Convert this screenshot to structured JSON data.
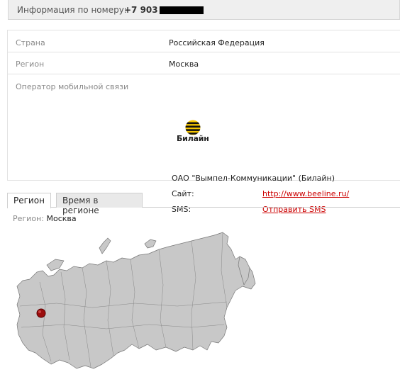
{
  "header": {
    "label": "Информация по номеру:",
    "number": "+7 903"
  },
  "info": {
    "rows": [
      {
        "key": "Страна",
        "value": "Российская Федерация"
      },
      {
        "key": "Регион",
        "value": "Москва"
      }
    ],
    "operator": {
      "key": "Оператор мобильной связи",
      "logo_text": "Билайн",
      "name": "ОАО \"Вымпел-Коммуникации\" (Билайн)",
      "site_label": "Сайт:",
      "site_link": "http://www.beeline.ru/",
      "sms_label": "SMS:",
      "sms_link": "Отправить SMS"
    }
  },
  "tabs": [
    {
      "label": "Регион",
      "active": true
    },
    {
      "label": "Время в регионе",
      "active": false
    }
  ],
  "region_panel": {
    "key": "Регион:",
    "value": "Москва"
  },
  "colors": {
    "link": "#cc0000",
    "map_fill": "#c8c8c8",
    "marker": "#9b0d0d",
    "logo_yellow": "#f4c400"
  }
}
